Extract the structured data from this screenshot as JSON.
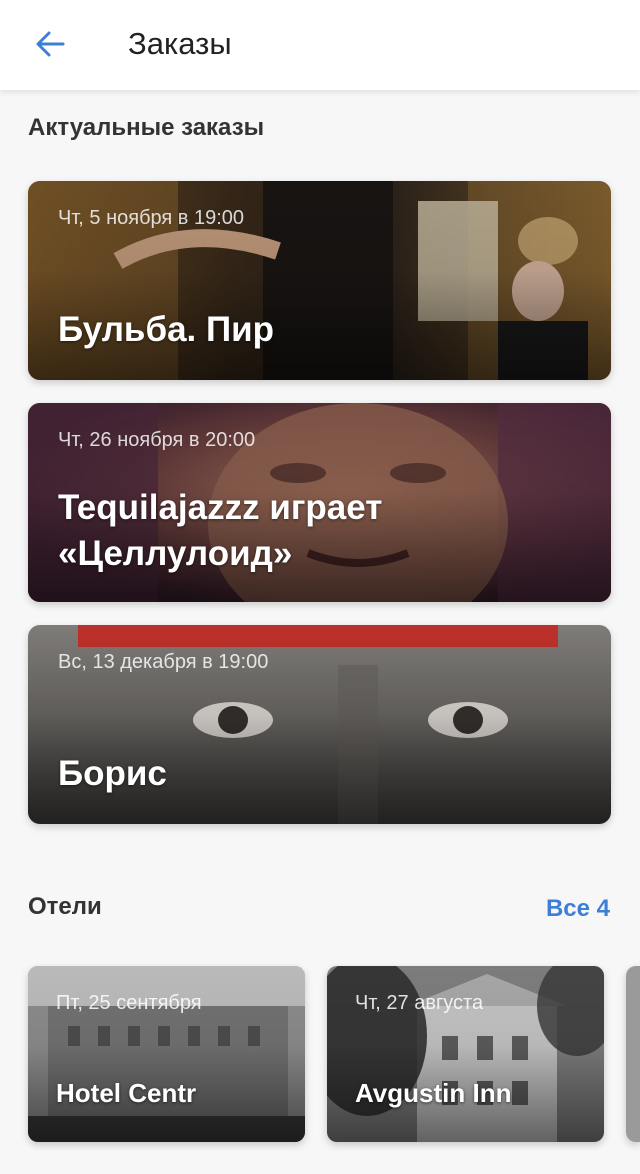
{
  "header": {
    "title": "Заказы"
  },
  "orders_section": {
    "title": "Актуальные заказы",
    "items": [
      {
        "date": "Чт, 5 ноября в 19:00",
        "title": "Бульба. Пир"
      },
      {
        "date": "Чт, 26 ноября в 20:00",
        "title": "Tequilajazzz играет «Целлулоид»"
      },
      {
        "date": "Вс, 13 декабря в 19:00",
        "title": "Борис"
      }
    ]
  },
  "hotels_section": {
    "title": "Отели",
    "see_all": "Все 4",
    "items": [
      {
        "date": "Пт, 25 сентября",
        "name": "Hotel Centr"
      },
      {
        "date": "Чт, 27 августа",
        "name": "Avgustin Inn"
      }
    ]
  },
  "colors": {
    "accent": "#3d7fd6",
    "background": "#f7f7f8"
  }
}
